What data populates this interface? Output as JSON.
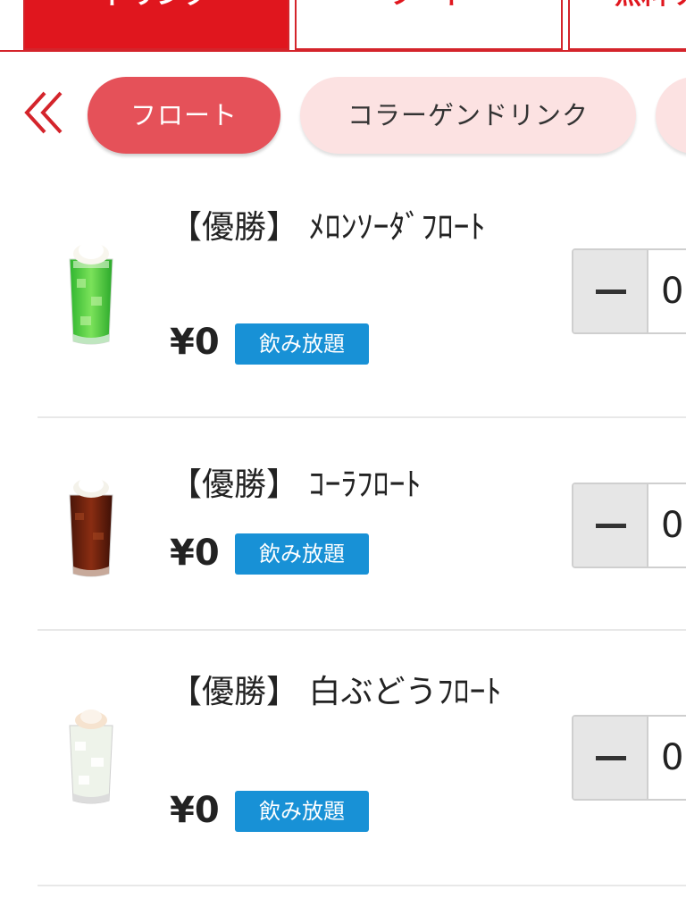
{
  "top_tabs": [
    {
      "label": "ドリンク"
    },
    {
      "label": "フード"
    },
    {
      "label": "無料サ"
    }
  ],
  "sub_categories": [
    {
      "label": "フロート"
    },
    {
      "label": "コラーゲンドリンク"
    },
    {
      "label": ""
    }
  ],
  "items": [
    {
      "name": "【優勝】 ﾒﾛﾝｿｰﾀﾞﾌﾛｰﾄ",
      "price": "¥0",
      "badge": "飲み放題",
      "quantity": "0"
    },
    {
      "name": "【優勝】 ｺｰﾗﾌﾛｰﾄ",
      "price": "¥0",
      "badge": "飲み放題",
      "quantity": "0"
    },
    {
      "name": "【優勝】 白ぶどうﾌﾛｰﾄ",
      "price": "¥0",
      "badge": "飲み放題",
      "quantity": "0"
    }
  ],
  "colors": {
    "brand_red": "#e0161e",
    "chip_active": "#e55159",
    "chip_inactive": "#fce2e2",
    "badge_blue": "#1891d6"
  },
  "icons": {
    "back": "double-chevron-left-icon",
    "minus": "minus-icon"
  }
}
